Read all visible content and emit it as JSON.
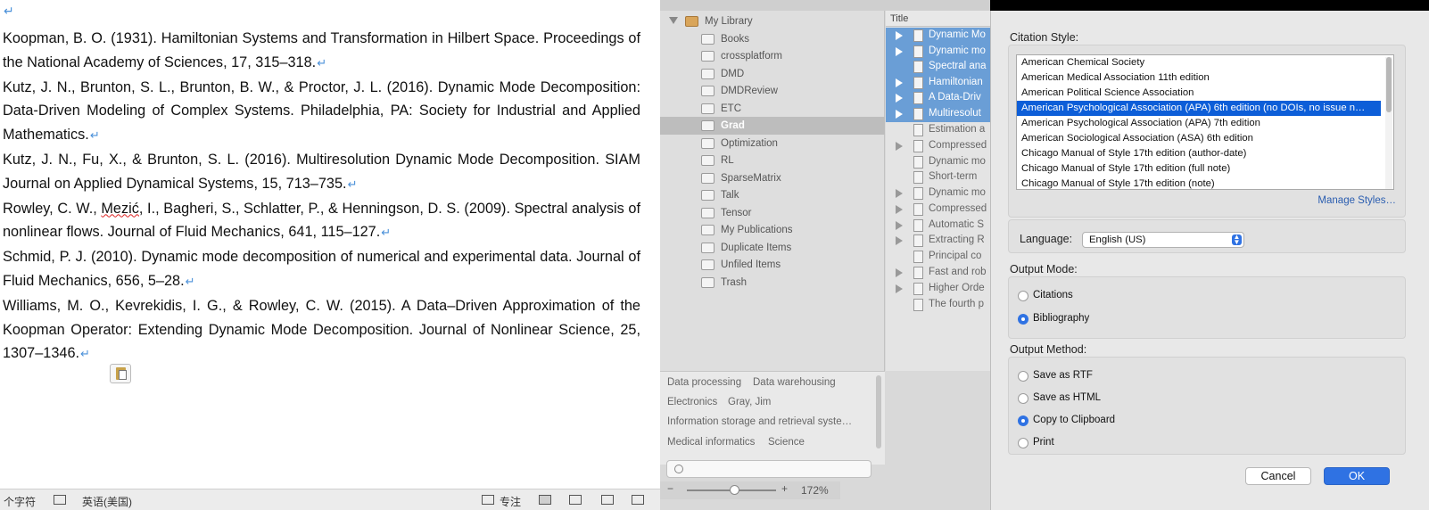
{
  "document": {
    "paragraph_mark": "↵",
    "references": [
      {
        "text": "Koopman, B. O. (1931). Hamiltonian Systems and Transformation in Hilbert Space. Proceedings of the National Academy of Sciences, 17, 315–318."
      },
      {
        "text": "Kutz, J. N., Brunton, S. L., Brunton, B. W., & Proctor, J. L. (2016). Dynamic Mode Decomposition: Data-Driven Modeling of Complex Systems. Philadelphia, PA: Society for Industrial and Applied Mathematics."
      },
      {
        "text": "Kutz, J. N., Fu, X., & Brunton, S. L. (2016). Multiresolution Dynamic Mode Decomposition. SIAM Journal on Applied Dynamical Systems, 15, 713–735."
      },
      {
        "pre": "Rowley, C. W., ",
        "misspelled": "Mezić",
        "post": ", I., Bagheri, S., Schlatter, P., & Henningson, D. S. (2009). Spectral analysis of nonlinear flows. Journal of Fluid Mechanics, 641, 115–127."
      },
      {
        "text": "Schmid, P. J. (2010). Dynamic mode decomposition of numerical and experimental data. Journal of Fluid Mechanics, 656, 5–28."
      },
      {
        "text": "Williams, M. O., Kevrekidis, I. G., & Rowley, C. W. (2015). A Data–Driven Approximation of the Koopman Operator: Extending Dynamic Mode Decomposition. Journal of Nonlinear Science, 25, 1307–1346."
      }
    ]
  },
  "statusbar": {
    "word_count": "个字符",
    "language": "英语(美国)",
    "focus": "专注",
    "zoom": "172%"
  },
  "zotero": {
    "collections": [
      {
        "label": "My Library",
        "root": true
      },
      {
        "label": "Books"
      },
      {
        "label": "crossplatform"
      },
      {
        "label": "DMD"
      },
      {
        "label": "DMDReview"
      },
      {
        "label": "ETC"
      },
      {
        "label": "Grad",
        "selected": true
      },
      {
        "label": "Optimization"
      },
      {
        "label": "RL"
      },
      {
        "label": "SparseMatrix"
      },
      {
        "label": "Talk"
      },
      {
        "label": "Tensor"
      },
      {
        "label": "My Publications"
      },
      {
        "label": "Duplicate Items"
      },
      {
        "label": "Unfiled Items"
      },
      {
        "label": "Trash"
      }
    ],
    "items_header": "Title",
    "items": [
      {
        "title": "Dynamic Mo",
        "selected": true,
        "arrow": true
      },
      {
        "title": "Dynamic mo",
        "selected": true,
        "arrow": true
      },
      {
        "title": "Spectral ana",
        "selected": true,
        "arrow": false
      },
      {
        "title": "Hamiltonian",
        "selected": true,
        "arrow": true
      },
      {
        "title": "A Data-Driv",
        "selected": true,
        "arrow": true
      },
      {
        "title": "Multiresolut",
        "selected": true,
        "arrow": true
      },
      {
        "title": "Estimation a",
        "selected": false,
        "arrow": false
      },
      {
        "title": "Compressed",
        "selected": false,
        "arrow": true
      },
      {
        "title": "Dynamic mo",
        "selected": false,
        "arrow": false
      },
      {
        "title": "Short-term",
        "selected": false,
        "arrow": false
      },
      {
        "title": "Dynamic mo",
        "selected": false,
        "arrow": true
      },
      {
        "title": "Compressed",
        "selected": false,
        "arrow": true
      },
      {
        "title": "Automatic S",
        "selected": false,
        "arrow": true
      },
      {
        "title": "Extracting R",
        "selected": false,
        "arrow": true
      },
      {
        "title": "Principal co",
        "selected": false,
        "arrow": false
      },
      {
        "title": "Fast and rob",
        "selected": false,
        "arrow": true
      },
      {
        "title": "Higher Orde",
        "selected": false,
        "arrow": true
      },
      {
        "title": "The fourth p",
        "selected": false,
        "arrow": false
      }
    ],
    "tags": [
      "Data processing",
      "Data warehousing",
      "Electronics",
      "Gray, Jim",
      "Information storage and retrieval syste…",
      "Medical informatics",
      "Science"
    ]
  },
  "dialog": {
    "citation_style_label": "Citation Style:",
    "styles": [
      {
        "label": "American Chemical Society"
      },
      {
        "label": "American Medical Association 11th edition"
      },
      {
        "label": "American Political Science Association"
      },
      {
        "label": "American Psychological Association (APA) 6th edition (no DOIs, no issue n…",
        "selected": true
      },
      {
        "label": "American Psychological Association (APA) 7th edition"
      },
      {
        "label": "American Sociological Association (ASA) 6th edition"
      },
      {
        "label": "Chicago Manual of Style 17th edition (author-date)"
      },
      {
        "label": "Chicago Manual of Style 17th edition (full note)"
      },
      {
        "label": "Chicago Manual of Style 17th edition (note)"
      }
    ],
    "manage_styles": "Manage Styles…",
    "language_label": "Language:",
    "language_value": "English (US)",
    "output_mode_label": "Output Mode:",
    "output_modes": [
      {
        "label": "Citations",
        "checked": false
      },
      {
        "label": "Bibliography",
        "checked": true
      }
    ],
    "output_method_label": "Output Method:",
    "output_methods": [
      {
        "label": "Save as RTF",
        "checked": false
      },
      {
        "label": "Save as HTML",
        "checked": false
      },
      {
        "label": "Copy to Clipboard",
        "checked": true
      },
      {
        "label": "Print",
        "checked": false
      }
    ],
    "cancel_label": "Cancel",
    "ok_label": "OK"
  }
}
